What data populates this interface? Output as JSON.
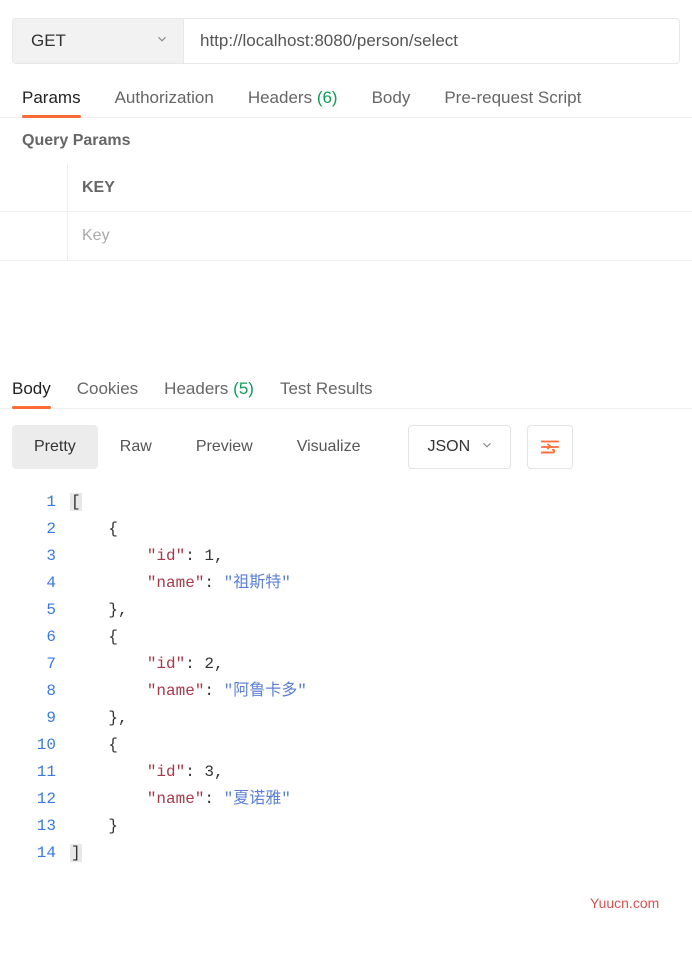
{
  "request": {
    "method": "GET",
    "url": "http://localhost:8080/person/select"
  },
  "requestTabs": {
    "params": "Params",
    "authorization": "Authorization",
    "headers_label": "Headers",
    "headers_count": "(6)",
    "body": "Body",
    "prerequest": "Pre-request Script"
  },
  "queryParams": {
    "title": "Query Params",
    "header_key": "KEY",
    "placeholder_key": "Key"
  },
  "responseTabs": {
    "body": "Body",
    "cookies": "Cookies",
    "headers_label": "Headers",
    "headers_count": "(5)",
    "tests": "Test Results"
  },
  "viewModes": {
    "pretty": "Pretty",
    "raw": "Raw",
    "preview": "Preview",
    "visualize": "Visualize",
    "format": "JSON"
  },
  "codeLines": [
    {
      "n": "1",
      "indent": 0,
      "fold": true,
      "tokens": [
        [
          "punct",
          "["
        ]
      ]
    },
    {
      "n": "2",
      "indent": 1,
      "fold": false,
      "tokens": [
        [
          "punct",
          "{"
        ]
      ]
    },
    {
      "n": "3",
      "indent": 2,
      "fold": false,
      "tokens": [
        [
          "key",
          "\"id\""
        ],
        [
          "punct",
          ": "
        ],
        [
          "num",
          "1"
        ],
        [
          "punct",
          ","
        ]
      ]
    },
    {
      "n": "4",
      "indent": 2,
      "fold": false,
      "tokens": [
        [
          "key",
          "\"name\""
        ],
        [
          "punct",
          ": "
        ],
        [
          "str",
          "\"祖斯特\""
        ]
      ]
    },
    {
      "n": "5",
      "indent": 1,
      "fold": false,
      "tokens": [
        [
          "punct",
          "},"
        ]
      ]
    },
    {
      "n": "6",
      "indent": 1,
      "fold": false,
      "tokens": [
        [
          "punct",
          "{"
        ]
      ]
    },
    {
      "n": "7",
      "indent": 2,
      "fold": false,
      "tokens": [
        [
          "key",
          "\"id\""
        ],
        [
          "punct",
          ": "
        ],
        [
          "num",
          "2"
        ],
        [
          "punct",
          ","
        ]
      ]
    },
    {
      "n": "8",
      "indent": 2,
      "fold": false,
      "tokens": [
        [
          "key",
          "\"name\""
        ],
        [
          "punct",
          ": "
        ],
        [
          "str",
          "\"阿鲁卡多\""
        ]
      ]
    },
    {
      "n": "9",
      "indent": 1,
      "fold": false,
      "tokens": [
        [
          "punct",
          "},"
        ]
      ]
    },
    {
      "n": "10",
      "indent": 1,
      "fold": false,
      "tokens": [
        [
          "punct",
          "{"
        ]
      ]
    },
    {
      "n": "11",
      "indent": 2,
      "fold": false,
      "tokens": [
        [
          "key",
          "\"id\""
        ],
        [
          "punct",
          ": "
        ],
        [
          "num",
          "3"
        ],
        [
          "punct",
          ","
        ]
      ]
    },
    {
      "n": "12",
      "indent": 2,
      "fold": false,
      "tokens": [
        [
          "key",
          "\"name\""
        ],
        [
          "punct",
          ": "
        ],
        [
          "str",
          "\"夏诺雅\""
        ]
      ]
    },
    {
      "n": "13",
      "indent": 1,
      "fold": false,
      "tokens": [
        [
          "punct",
          "}"
        ]
      ]
    },
    {
      "n": "14",
      "indent": 0,
      "fold": true,
      "tokens": [
        [
          "punct",
          "]"
        ]
      ]
    }
  ],
  "watermark": "Yuucn.com"
}
